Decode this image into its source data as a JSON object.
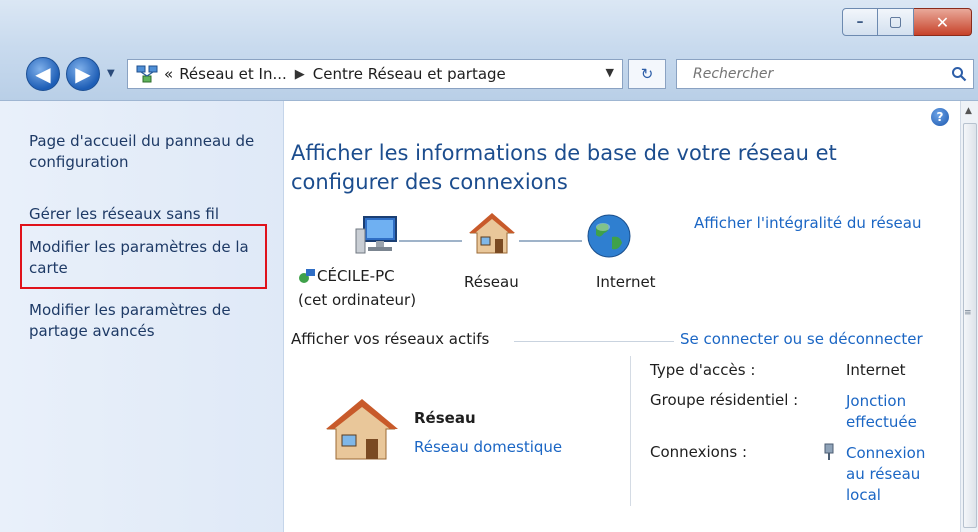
{
  "window": {
    "controls": {
      "minimize": "–",
      "maximize": "▢",
      "close": "✕"
    }
  },
  "toolbar": {
    "back": "◀",
    "forward": "▶",
    "breadcrumb": {
      "overflow": "«",
      "item1": "Réseau et In...",
      "separator": "▶",
      "item2": "Centre Réseau et partage"
    },
    "refresh": "↻",
    "search_placeholder": "Rechercher"
  },
  "sidebar": {
    "items": [
      {
        "label": "Page d'accueil du panneau de configuration"
      },
      {
        "label": "Gérer les réseaux sans fil"
      },
      {
        "label": "Modifier les paramètres de la carte"
      },
      {
        "label": "Modifier les paramètres de partage avancés"
      }
    ]
  },
  "main": {
    "heading": "Afficher les informations de base de votre réseau et configurer des connexions",
    "full_map_link": "Afficher l'intégralité du réseau",
    "map": {
      "computer_name": "CÉCILE-PC",
      "computer_sub": "(cet ordinateur)",
      "network": "Réseau",
      "internet": "Internet"
    },
    "active_section_title": "Afficher vos réseaux actifs",
    "connect_link": "Se connecter ou se déconnecter",
    "active_network": {
      "name": "Réseau",
      "type_link": "Réseau domestique",
      "access_type_label": "Type d'accès :",
      "access_type_value": "Internet",
      "homegroup_label": "Groupe résidentiel :",
      "homegroup_value": "Jonction effectuée",
      "connections_label": "Connexions :",
      "connections_value": "Connexion au réseau local"
    }
  },
  "help_icon": "?",
  "colors": {
    "link": "#1b66c4",
    "heading": "#1c4d8e",
    "highlight_border": "#e0121b"
  }
}
